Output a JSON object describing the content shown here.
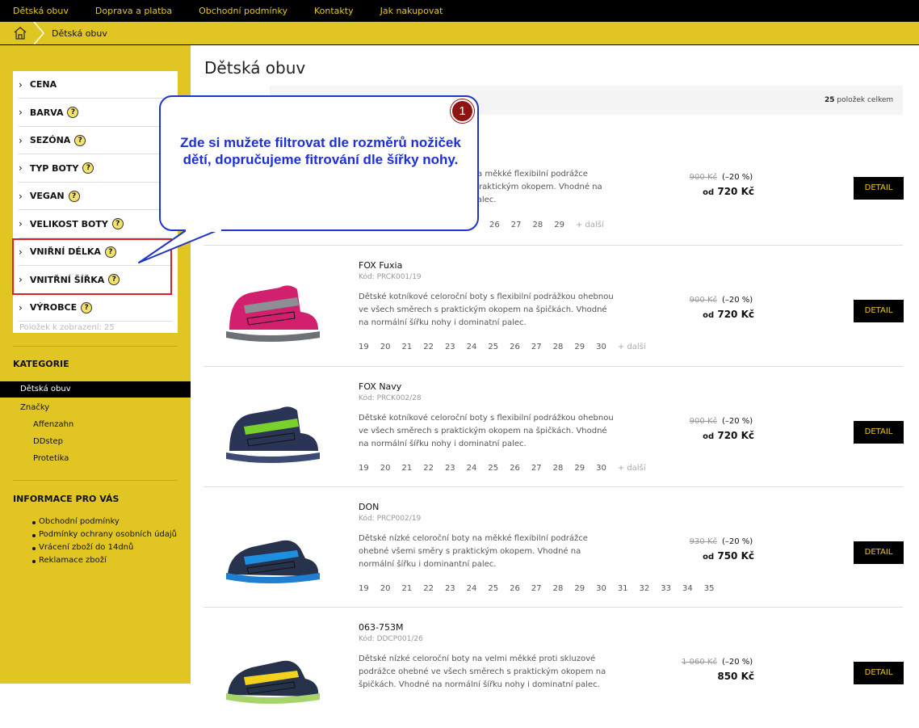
{
  "topnav": [
    "Dětská obuv",
    "Doprava a platba",
    "Obchodní podmínky",
    "Kontakty",
    "Jak nakupovat"
  ],
  "breadcrumb": {
    "current": "Dětská obuv"
  },
  "filters": [
    {
      "label": "CENA",
      "help": false
    },
    {
      "label": "BARVA",
      "help": true
    },
    {
      "label": "SEZÓNA",
      "help": true
    },
    {
      "label": "TYP BOTY",
      "help": true
    },
    {
      "label": "VEGAN",
      "help": true
    },
    {
      "label": "VELIKOST BOTY",
      "help": true
    },
    {
      "label": "VNIŘNÍ DÉLKA",
      "help": true
    },
    {
      "label": "VNITŘNÍ ŠÍŘKA",
      "help": true
    },
    {
      "label": "VÝROBCE",
      "help": true
    }
  ],
  "help_glyph": "?",
  "filter_count": "Položek k zobrazení: 25",
  "categories": {
    "heading": "KATEGORIE",
    "active": "Dětská obuv",
    "brands": "Značky",
    "brand_items": [
      "Affenzahn",
      "DDstep",
      "Protetika"
    ]
  },
  "info": {
    "heading": "INFORMACE PRO VÁS",
    "items": [
      "Obchodní podmínky",
      "Podmínky ochrany osobních údajů",
      "Vrácení zboží do 14dnů",
      "Reklamace zboží"
    ]
  },
  "page_title": "Dětská obuv",
  "total": {
    "count": "25",
    "label": "položek celkem"
  },
  "callout": {
    "number": "1",
    "text": "Zde si mužete filtrovat dle rozměrů nožiček dětí, dopručujeme fitrování dle šířky nohy."
  },
  "products": [
    {
      "name": "",
      "code": "",
      "desc": "Dětské nízké celoroční boty na měkké flexibilní podrážce ohebné ve všech směrech s praktickým okopem. Vhodné na normální šířku i dominantní palec.",
      "sizes": [
        "26",
        "27",
        "28",
        "29"
      ],
      "more": "+ další",
      "old": "900 Kč",
      "disc": "(–20 %)",
      "price": "720 Kč",
      "from": "od",
      "detail": "DETAIL",
      "colors": {
        "upper": "#2a3552",
        "accent": "#e2367a",
        "sole": "#9aa0a6"
      }
    },
    {
      "name": "FOX Fuxia",
      "code": "Kód: PRCK001/19",
      "desc": "Dětské kotníkové celoroční boty s flexibilní podrážkou ohebnou ve všech směrech s praktickým okopem na špičkách. Vhodné na normální šířku nohy i dominatní palec.",
      "sizes": [
        "19",
        "20",
        "21",
        "22",
        "23",
        "24",
        "25",
        "26",
        "27",
        "28",
        "29",
        "30"
      ],
      "more": "+ další",
      "old": "900 Kč",
      "disc": "(–20 %)",
      "price": "720 Kč",
      "from": "od",
      "detail": "DETAIL",
      "colors": {
        "upper": "#d0206e",
        "accent": "#8c8f94",
        "sole": "#6d7176"
      }
    },
    {
      "name": "FOX Navy",
      "code": "Kód: PRCK002/28",
      "desc": "Dětské kotníkové celoroční boty s flexibilní podrážkou ohebnou ve všech směrech s praktickým okopem na špičkách. Vhodné na normální šířku nohy i dominatní palec.",
      "sizes": [
        "19",
        "20",
        "21",
        "22",
        "23",
        "24",
        "25",
        "26",
        "27",
        "28",
        "29",
        "30"
      ],
      "more": "+ další",
      "old": "900 Kč",
      "disc": "(–20 %)",
      "price": "720 Kč",
      "from": "od",
      "detail": "DETAIL",
      "colors": {
        "upper": "#2a3556",
        "accent": "#7bd12c",
        "sole": "#3d4a74"
      }
    },
    {
      "name": "DON",
      "code": "Kód: PRCP002/19",
      "desc": "Dětské nízké celoroční boty na měkké flexibilní podrážce ohebné všemi směry s praktickým okopem. Vhodné na normální šířku i dominantní palec.",
      "sizes": [
        "19",
        "20",
        "21",
        "22",
        "23",
        "24",
        "25",
        "26",
        "27",
        "28",
        "29",
        "30",
        "31",
        "32",
        "33",
        "34",
        "35"
      ],
      "more": "",
      "old": "930 Kč",
      "disc": "(–20 %)",
      "price": "750 Kč",
      "from": "od",
      "detail": "DETAIL",
      "colors": {
        "upper": "#27334d",
        "accent": "#1e8fe0",
        "sole": "#1e7fd0"
      }
    },
    {
      "name": "063-753M",
      "code": "Kód: DDCP001/26",
      "desc": "Dětské nízké celoroční boty na velmi měkké proti skluzové podrážce ohebné ve všech směrech s praktickým okopem na špičkách. Vhodné na normální šířku nohy i dominatní palec.",
      "sizes": [],
      "more": "",
      "old": "1 060 Kč",
      "disc": "(–20 %)",
      "price": "850 Kč",
      "from": "",
      "detail": "DETAIL",
      "colors": {
        "upper": "#26324a",
        "accent": "#f2d21b",
        "sole": "#a6d36a"
      }
    }
  ]
}
